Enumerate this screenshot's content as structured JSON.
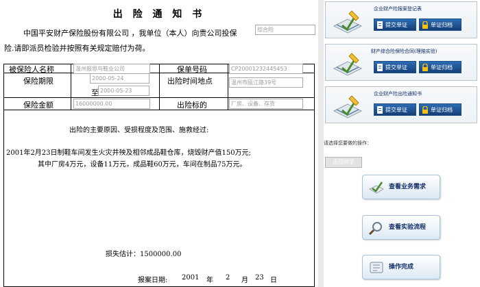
{
  "document": {
    "title": "出 险 通 知 书",
    "intro_line1": "中国平安财产保险股份有限公司 ，我单位（本人）向贵公司投保",
    "policy_type_value": "综合险",
    "intro_line2": "险.请即派员检验并按照有关规定赔付为荷。",
    "labels": {
      "insured_name": "被保险人名称",
      "policy_no": "保单号码",
      "period": "保险期限",
      "to": "至",
      "time_place": "出险时间地点",
      "amount": "保险金额",
      "subject": "出险标的"
    },
    "fields": {
      "insured_name": "温州报恩鸟鞋业公司",
      "policy_no": "CP20001232445453",
      "period_start": "2000-05-24",
      "period_end": "2000-05-23",
      "time_place": "温州市瓯江路39号",
      "amount": "16000000.00",
      "subject": "厂房、设备、存货"
    },
    "section_heading": "出险的主要原因、受损程度及范围、施救经过:",
    "narrative_line1": "2001年2月23日制鞋车间发生火灾并殃及相邻成品鞋仓库，烧毁财产值150万元;",
    "narrative_line2": "其中厂房4万元，设备11万元，成品鞋60万元，车间在制品75万元。",
    "loss_estimate": "损失估计：1500000.00",
    "report_date": {
      "label": "报案日期:",
      "year": "2001",
      "year_unit": "年",
      "month": "2",
      "month_unit": "月",
      "day": "23",
      "day_unit": "日"
    }
  },
  "sidebar": {
    "cards": [
      {
        "title": "企业财产险报案登记表",
        "submit": "提交单证",
        "archive": "单证归档"
      },
      {
        "title": "财产综合险保险合同(理赔实验)",
        "submit": "提交单证",
        "archive": "单证归档"
      },
      {
        "title": "企业财产险出险通知书",
        "submit": "提交单证",
        "archive": "单证归档"
      }
    ],
    "prompt": "请选择您要做的操作：",
    "back_button": "返回师学",
    "actions": [
      {
        "label": "查看业务需求",
        "icon": "checkmark-icon"
      },
      {
        "label": "查看实验流程",
        "icon": "magnifier-icon"
      },
      {
        "label": "操作完成",
        "icon": "complete-icon"
      }
    ]
  },
  "colors": {
    "button_blue": "#1f5ba0",
    "card_title": "#0f2a6a",
    "action_text": "#16306a"
  }
}
